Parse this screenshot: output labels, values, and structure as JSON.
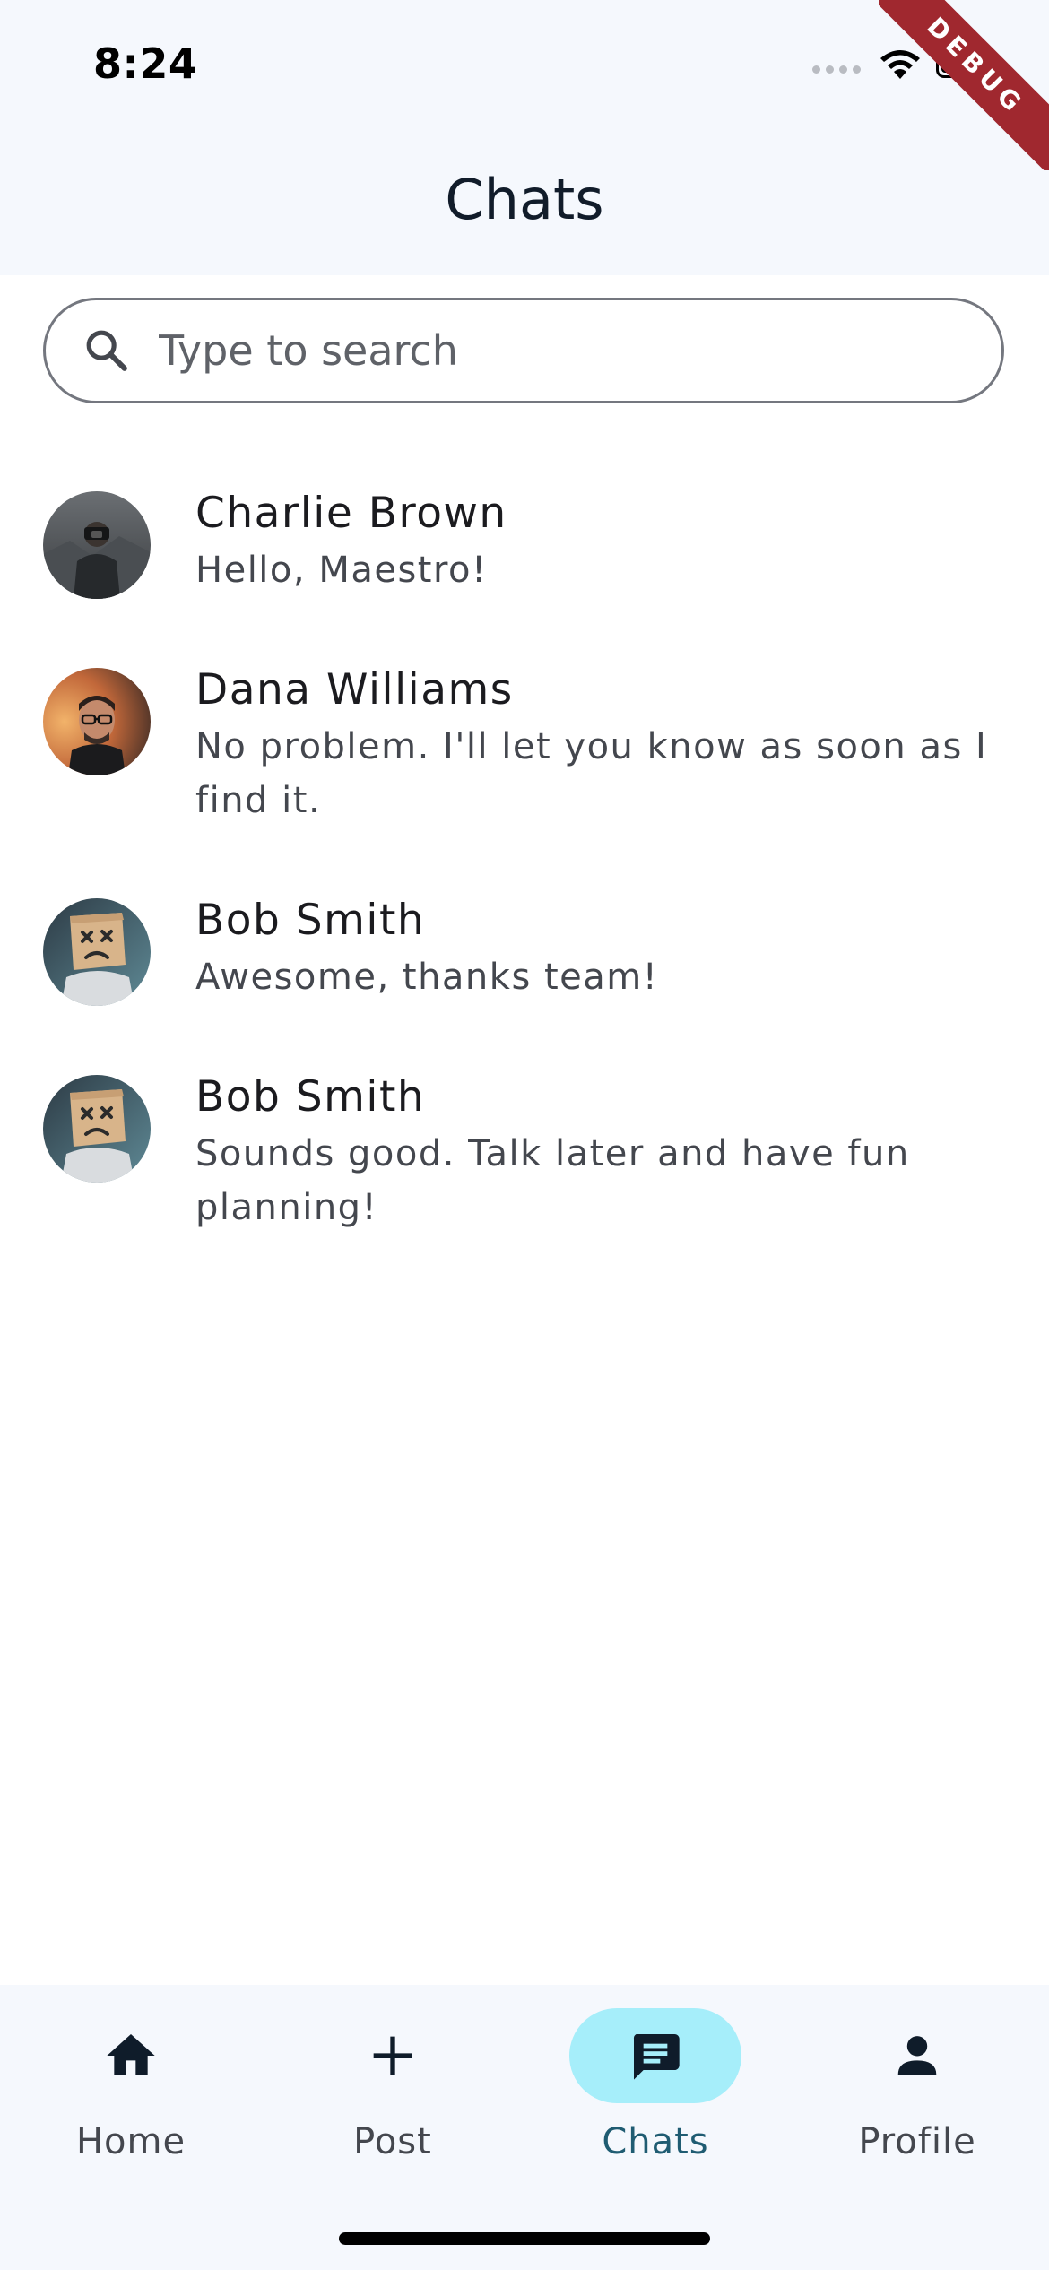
{
  "status_bar": {
    "time": "8:24",
    "debug_banner": "DEBUG"
  },
  "app_bar": {
    "title": "Chats"
  },
  "search": {
    "placeholder": "Type to search",
    "value": ""
  },
  "chats": [
    {
      "name": "Charlie Brown",
      "message": "Hello, Maestro!",
      "avatar": "man-with-camera-avatar"
    },
    {
      "name": "Dana Williams",
      "message": "No problem. I'll let you know as soon as I find it.",
      "avatar": "man-with-glasses-avatar"
    },
    {
      "name": "Bob Smith",
      "message": "Awesome, thanks team!",
      "avatar": "boxhead-mask-avatar"
    },
    {
      "name": "Bob Smith",
      "message": "Sounds good. Talk later and have fun planning!",
      "avatar": "boxhead-mask-avatar"
    }
  ],
  "bottom_nav": {
    "items": [
      {
        "label": "Home",
        "icon": "home-icon",
        "active": false
      },
      {
        "label": "Post",
        "icon": "plus-icon",
        "active": false
      },
      {
        "label": "Chats",
        "icon": "chat-icon",
        "active": true
      },
      {
        "label": "Profile",
        "icon": "person-icon",
        "active": false
      }
    ]
  },
  "colors": {
    "app_bar_bg": "#f5f8fd",
    "active_pill": "#a6eefa",
    "active_label": "#1f5c72",
    "debug_ribbon": "#a0282f"
  }
}
